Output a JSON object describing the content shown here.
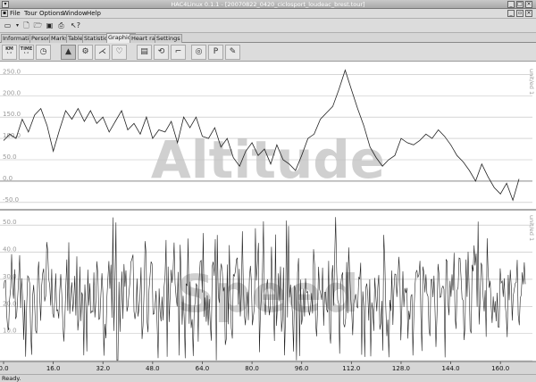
{
  "window": {
    "title": "HAC4Linux 0.1.1 - [20070822_0420_ciclosport_loudeac_brest.tour]"
  },
  "menu": [
    "File",
    "Tour",
    "Options",
    "Window",
    "Help"
  ],
  "tabs": [
    {
      "label": "Information",
      "active": false
    },
    {
      "label": "Person",
      "active": false
    },
    {
      "label": "Marks",
      "active": false
    },
    {
      "label": "Table",
      "active": false
    },
    {
      "label": "Statistics",
      "active": false
    },
    {
      "label": "Graphics",
      "active": true
    },
    {
      "label": "Heart rate",
      "active": false
    },
    {
      "label": "Settings",
      "active": false
    }
  ],
  "graph_toolbar": {
    "km_label": "KM",
    "time_label": "TIME",
    "p_label": "P"
  },
  "status": "Ready.",
  "chart_data": [
    {
      "type": "line",
      "watermark": "Altitude",
      "side_label": "unit/ed 1",
      "y_ticks": [
        "250.0",
        "200.0",
        "150.0",
        "100.0",
        "50.0",
        "0.0",
        "-50.0"
      ],
      "ylim": [
        -65,
        280
      ],
      "grid": true,
      "x": [
        0,
        2,
        4,
        6,
        8,
        10,
        12,
        14,
        16,
        18,
        20,
        22,
        24,
        26,
        28,
        30,
        32,
        34,
        36,
        38,
        40,
        42,
        44,
        46,
        48,
        50,
        52,
        54,
        56,
        58,
        60,
        62,
        64,
        66,
        68,
        70,
        72,
        74,
        76,
        78,
        80,
        82,
        84,
        86,
        88,
        90,
        92,
        94,
        96,
        98,
        100,
        102,
        104,
        106,
        108,
        110,
        112,
        114,
        116,
        118,
        120,
        122,
        124,
        126,
        128,
        130,
        132,
        134,
        136,
        138,
        140,
        142,
        144,
        146,
        148,
        150,
        152,
        154,
        156,
        158,
        160,
        162,
        164,
        166
      ],
      "values": [
        95,
        110,
        100,
        145,
        115,
        155,
        170,
        130,
        70,
        120,
        165,
        145,
        170,
        140,
        165,
        135,
        150,
        115,
        140,
        165,
        120,
        135,
        110,
        150,
        100,
        120,
        115,
        140,
        90,
        150,
        125,
        150,
        105,
        100,
        125,
        80,
        100,
        55,
        35,
        70,
        90,
        60,
        75,
        40,
        85,
        50,
        40,
        25,
        60,
        100,
        110,
        145,
        160,
        175,
        215,
        260,
        215,
        170,
        130,
        80,
        55,
        35,
        50,
        60,
        100,
        90,
        85,
        95,
        110,
        100,
        120,
        105,
        85,
        60,
        45,
        25,
        0,
        40,
        10,
        -15,
        -30,
        -5,
        -45,
        5
      ]
    },
    {
      "type": "line",
      "watermark": "Speed",
      "side_label": "unit/ed 1",
      "y_ticks": [
        "50.0",
        "40.0",
        "30.0",
        "20.0",
        "10.0",
        "0.0"
      ],
      "ylim": [
        0,
        55
      ],
      "x_ticks": [
        "0.0",
        "16.0",
        "32.0",
        "48.0",
        "64.0",
        "80.0",
        "96.0",
        "112.0",
        "128.0",
        "144.0",
        "160.0"
      ],
      "xlim": [
        0,
        168
      ],
      "grid": true
    }
  ]
}
